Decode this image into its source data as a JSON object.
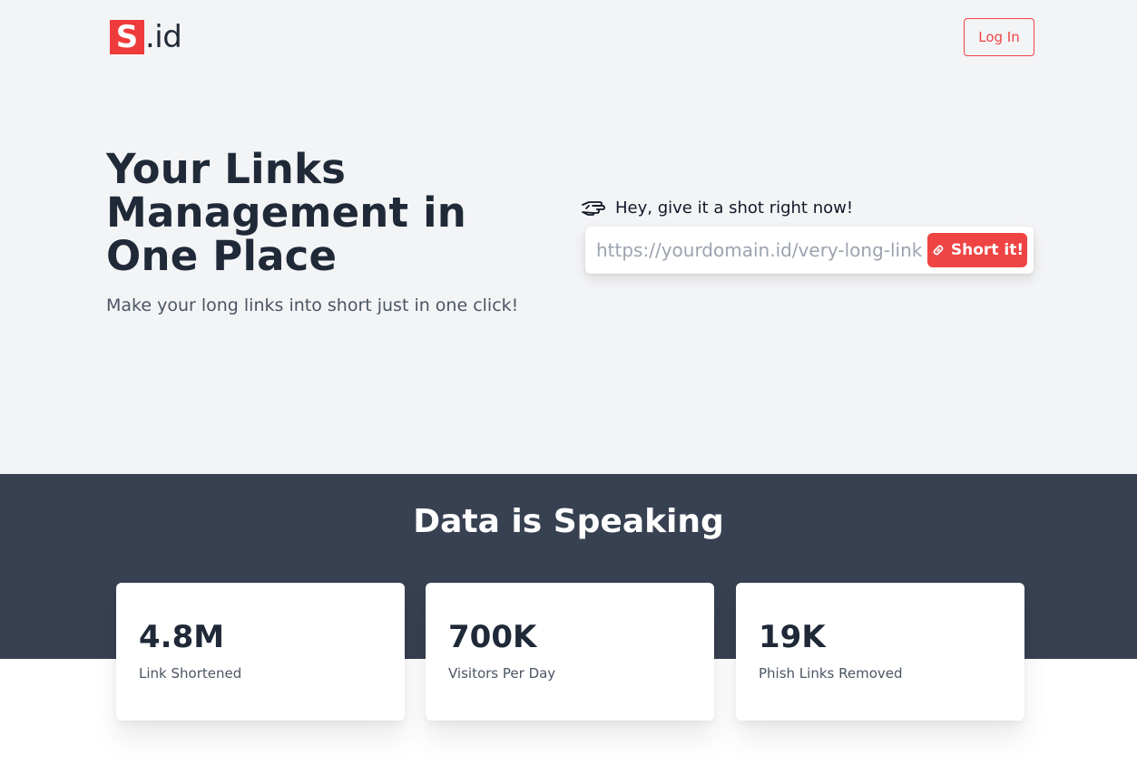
{
  "header": {
    "logo_mark": "S",
    "logo_text": ".id",
    "login_label": "Log In"
  },
  "hero": {
    "headline": "Your Links Management in One Place",
    "subline": "Make your long links into short just in one click!",
    "prompt": "Hey, give it a shot right now!",
    "prompt_icon": "pointing-hand-icon",
    "input_placeholder": "https://yourdomain.id/very-long-link",
    "input_value": "",
    "submit_label": "Short it!",
    "submit_icon": "link-icon"
  },
  "stats": {
    "title": "Data is Speaking",
    "items": [
      {
        "value": "4.8M",
        "label": "Link Shortened"
      },
      {
        "value": "700K",
        "label": "Visitors Per Day"
      },
      {
        "value": "19K",
        "label": "Phish Links Removed"
      }
    ]
  },
  "colors": {
    "accent": "#ef4444",
    "hero_bg": "#f3f4f6",
    "stats_bg": "#374151",
    "text_dark": "#1f2937"
  }
}
